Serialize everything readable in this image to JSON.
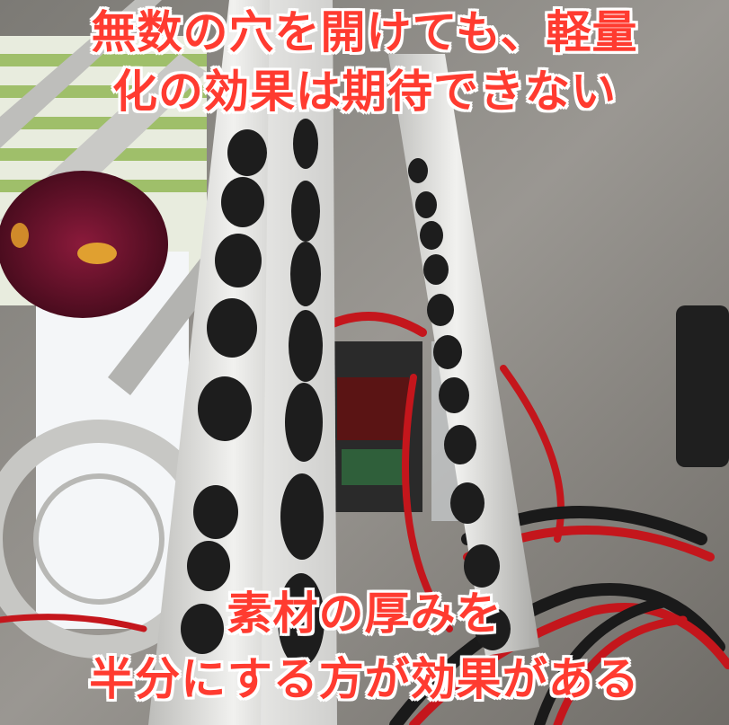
{
  "captions": {
    "top_line_1": "無数の穴を開けても、軽量",
    "top_line_2": "化の効果は期待できない",
    "bottom_line_1": "素材の厚みを",
    "bottom_line_2": "半分にする方が効果がある"
  },
  "colors": {
    "caption_fill": "#ff3b30",
    "caption_outline": "#ffffff",
    "floor": "#8d8a85",
    "aluminum": "#d9d9d7",
    "wire_red": "#c4161c",
    "wire_black": "#1a1a1a"
  }
}
